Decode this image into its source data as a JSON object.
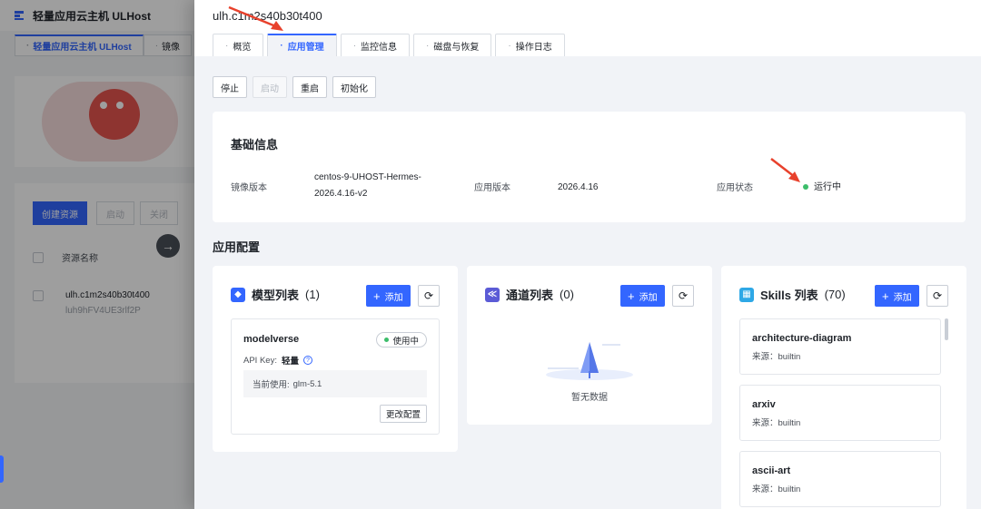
{
  "background": {
    "app_title": "轻量应用云主机 ULHost",
    "tabs": [
      {
        "label": "轻量应用云主机 ULHost"
      },
      {
        "label": "镜像"
      }
    ],
    "buttons": {
      "create": "创建资源",
      "start": "启动",
      "stop": "关闭"
    },
    "columns": {
      "name": "资源名称"
    },
    "row": {
      "name": "ulh.c1m2s40b30t400",
      "id": "luh9hFV4UE3rlf2P"
    }
  },
  "drawer": {
    "title": "ulh.c1m2s40b30t400",
    "tabs": [
      {
        "label": "概览",
        "active": false
      },
      {
        "label": "应用管理",
        "active": true
      },
      {
        "label": "监控信息",
        "active": false
      },
      {
        "label": "磁盘与恢复",
        "active": false
      },
      {
        "label": "操作日志",
        "active": false
      }
    ],
    "toolbar": {
      "stop": "停止",
      "start": "启动",
      "restart": "重启",
      "init": "初始化"
    },
    "basic": {
      "title": "基础信息",
      "image_label": "镜像版本",
      "image_value_line1": "centos-9-UHOST-Hermes-",
      "image_value_line2": "2026.4.16-v2",
      "app_version_label": "应用版本",
      "app_version_value": "2026.4.16",
      "status_label": "应用状态",
      "status_value": "运行中",
      "status_color": "#3cbd6a"
    },
    "config_title": "应用配置",
    "add_label": "添加",
    "models": {
      "title": "模型列表",
      "count": "(1)",
      "icon_color": "#3366ff",
      "items": [
        {
          "name": "modelverse",
          "badge": "使用中",
          "api_key_label": "API Key:",
          "api_key_value": "轻量",
          "current_label": "当前使用:",
          "current_value": "glm-5.1",
          "edit_label": "更改配置"
        }
      ]
    },
    "channels": {
      "title": "通道列表",
      "count": "(0)",
      "icon_color": "#5b5bd6",
      "empty_text": "暂无数据"
    },
    "skills": {
      "title": "Skills 列表",
      "count": "(70)",
      "icon_color": "#2ea8e6",
      "source_label": "来源：",
      "items": [
        {
          "name": "architecture-diagram",
          "source": "builtin"
        },
        {
          "name": "arxiv",
          "source": "builtin"
        },
        {
          "name": "ascii-art",
          "source": "builtin"
        }
      ]
    }
  },
  "accent_color": "#3366ff"
}
